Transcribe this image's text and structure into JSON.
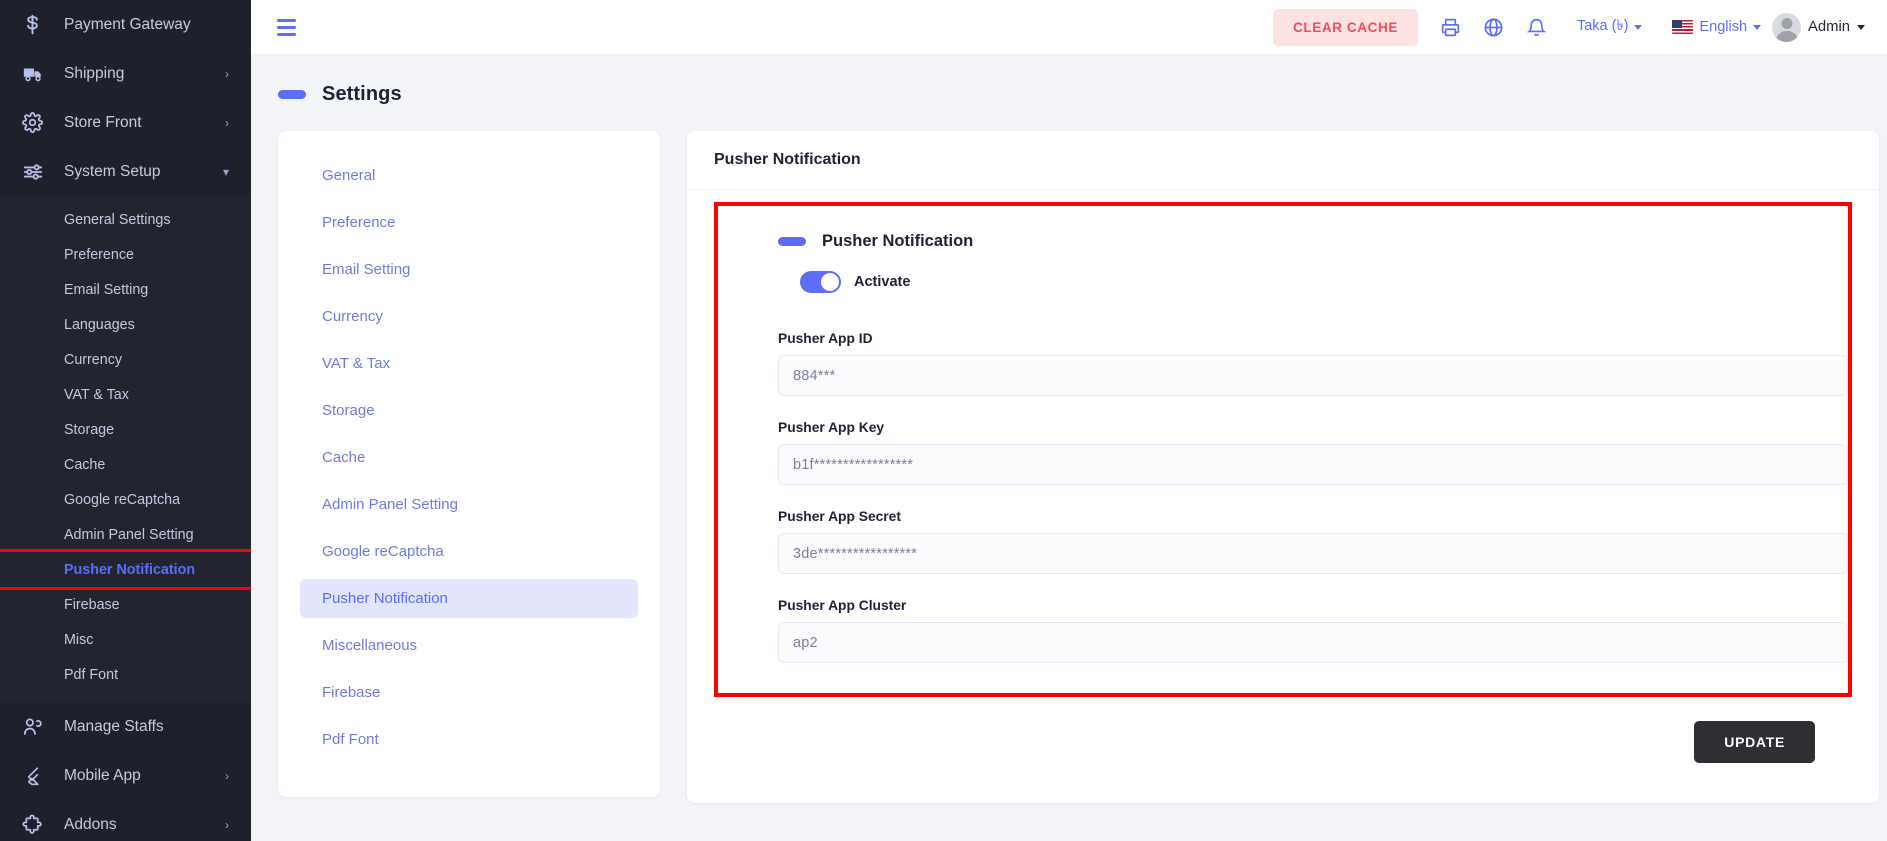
{
  "colors": {
    "accent": "#5b6ef5",
    "sidebar_bg": "#1e212b",
    "submenu_bg": "#22252f",
    "page_bg": "#f3f4f8",
    "danger": "#ef4d5a",
    "highlight": "#ff0000",
    "update_btn": "#2f2f33"
  },
  "sidebar": {
    "items": [
      {
        "label": "Payment Gateway",
        "icon": "dollar-icon",
        "has_caret": false
      },
      {
        "label": "Shipping",
        "icon": "truck-icon",
        "has_caret": true,
        "caret": "›"
      },
      {
        "label": "Store Front",
        "icon": "gear-icon",
        "has_caret": true,
        "caret": "›"
      },
      {
        "label": "System Setup",
        "icon": "sliders-icon",
        "has_caret": true,
        "caret": "⌄",
        "expanded": true
      }
    ],
    "submenu": [
      {
        "label": "General Settings"
      },
      {
        "label": "Preference"
      },
      {
        "label": "Email Setting"
      },
      {
        "label": "Languages"
      },
      {
        "label": "Currency"
      },
      {
        "label": "VAT & Tax"
      },
      {
        "label": "Storage"
      },
      {
        "label": "Cache"
      },
      {
        "label": "Google reCaptcha"
      },
      {
        "label": "Admin Panel Setting"
      },
      {
        "label": "Pusher Notification",
        "active": true,
        "highlighted": true
      },
      {
        "label": "Firebase"
      },
      {
        "label": "Misc"
      },
      {
        "label": "Pdf Font"
      }
    ],
    "items_after": [
      {
        "label": "Manage Staffs",
        "icon": "people-icon",
        "has_caret": false
      },
      {
        "label": "Mobile App",
        "icon": "flutter-icon",
        "has_caret": true,
        "caret": "›"
      },
      {
        "label": "Addons",
        "icon": "puzzle-icon",
        "has_caret": true,
        "caret": "›"
      }
    ]
  },
  "topbar": {
    "menu_toggle": "hamburger-icon",
    "clear_cache_label": "CLEAR CACHE",
    "print_icon": "printer-icon",
    "globe_icon": "globe-icon",
    "bell_icon": "bell-icon",
    "currency_label": "Taka (৳)",
    "language_label": "English",
    "language_flag": "us-flag-icon",
    "user_label": "Admin",
    "avatar": "avatar-icon"
  },
  "page": {
    "title": "Settings"
  },
  "settings_tabs": [
    {
      "label": "General"
    },
    {
      "label": "Preference"
    },
    {
      "label": "Email Setting"
    },
    {
      "label": "Currency"
    },
    {
      "label": "VAT & Tax"
    },
    {
      "label": "Storage"
    },
    {
      "label": "Cache"
    },
    {
      "label": "Admin Panel Setting"
    },
    {
      "label": "Google reCaptcha"
    },
    {
      "label": "Pusher Notification",
      "active": true
    },
    {
      "label": "Miscellaneous"
    },
    {
      "label": "Firebase"
    },
    {
      "label": "Pdf Font"
    }
  ],
  "form": {
    "card_title": "Pusher Notification",
    "section_title": "Pusher Notification",
    "activate_label": "Activate",
    "activate_on": true,
    "fields": [
      {
        "label": "Pusher App ID",
        "value": "884***"
      },
      {
        "label": "Pusher App Key",
        "value": "b1f*****************"
      },
      {
        "label": "Pusher App Secret",
        "value": "3de*****************"
      },
      {
        "label": "Pusher App Cluster",
        "value": "ap2"
      }
    ],
    "update_label": "UPDATE"
  }
}
